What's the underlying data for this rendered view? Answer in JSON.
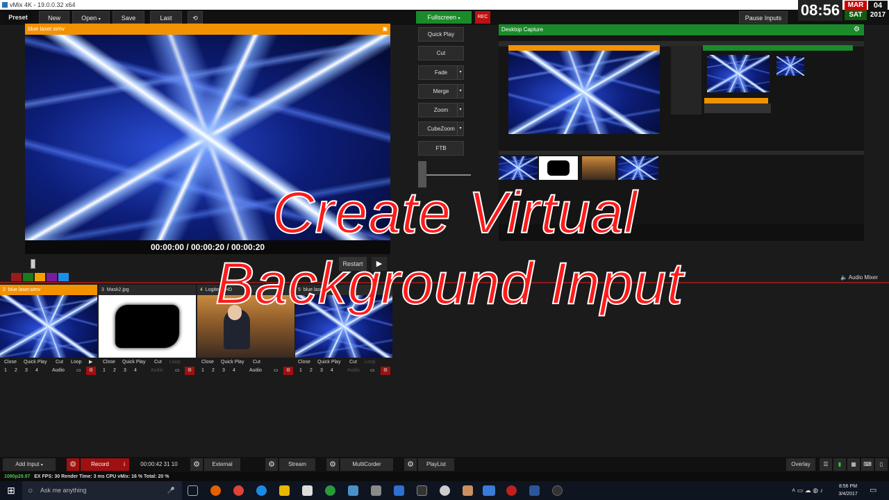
{
  "window": {
    "title": "vMix 4K - 19.0.0.32 x64"
  },
  "toolbar": {
    "preset": "Preset",
    "new": "New",
    "open": "Open",
    "save": "Save",
    "last": "Last",
    "fullscreen": "Fullscreen",
    "rec": "REC",
    "pause_inputs": "Pause Inputs"
  },
  "clock": {
    "time": "08:56",
    "month": "MAR",
    "day": "04",
    "weekday": "SAT",
    "year": "2017"
  },
  "preview": {
    "title": "blue laser.wmv",
    "time": "00:00:00  /  00:00:20  /  00:00:20",
    "restart": "Restart"
  },
  "transitions": {
    "quick_play": "Quick Play",
    "cut": "Cut",
    "fade": "Fade",
    "merge": "Merge",
    "zoom": "Zoom",
    "cubezoom": "CubeZoom",
    "ftb": "FTB"
  },
  "output": {
    "title": "Desktop Capture"
  },
  "overlay_text": {
    "line1": "Create Virtual",
    "line2": "Background Input"
  },
  "color_swatches": [
    "#9b1b1b",
    "#1b7a1b",
    "#f3a000",
    "#7a1b9b",
    "#1b8ee8"
  ],
  "audio_mixer": "Audio Mixer",
  "inputs": [
    {
      "num": "2",
      "name": "blue laser.wmv",
      "close": "Close",
      "quick_play": "Quick Play",
      "cut": "Cut",
      "loop": "Loop",
      "audio": "Audio"
    },
    {
      "num": "3",
      "name": "Mask2.jpg",
      "close": "Close",
      "quick_play": "Quick Play",
      "cut": "Cut",
      "loop": "Loop",
      "audio": "Audio"
    },
    {
      "num": "4",
      "name": "Logitech HD",
      "close": "Close",
      "quick_play": "Quick Play",
      "cut": "Cut",
      "loop": "",
      "audio": "Audio"
    },
    {
      "num": "5",
      "name": "blue laser.wmv",
      "close": "Close",
      "quick_play": "Quick Play",
      "cut": "Cut",
      "loop": "Loop",
      "audio": "Audio"
    }
  ],
  "overlay_channels": [
    "1",
    "2",
    "3",
    "4"
  ],
  "bottom": {
    "add_input": "Add Input",
    "record": "Record",
    "record_time": "00:00:42 31 10",
    "external": "External",
    "stream": "Stream",
    "multicorder": "MultiCorder",
    "playlist": "PlayList",
    "overlay": "Overlay"
  },
  "status": {
    "format": "1080p29.97",
    "stats": "EX  FPS: 30  Render Time: 3 ms  CPU vMix: 16 %  Total: 20 %"
  },
  "taskbar": {
    "search": "Ask me anything",
    "time": "8:56 PM",
    "date": "3/4/2017"
  }
}
